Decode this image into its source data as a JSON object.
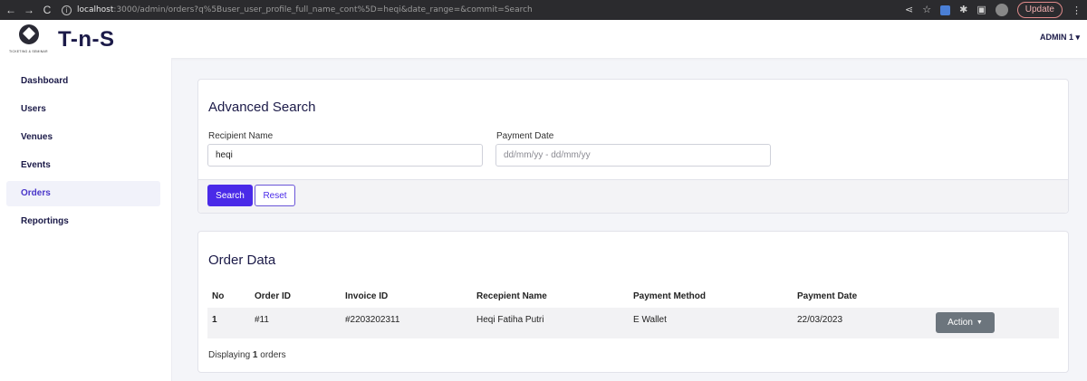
{
  "browser": {
    "url_host": "localhost",
    "url_rest": ":3000/admin/orders?q%5Buser_user_profile_full_name_cont%5D=heqi&date_range=&commit=Search",
    "update_label": "Update",
    "nav_back": "←",
    "nav_forward": "→",
    "nav_reload": "C",
    "share_icon": "share-icon",
    "star_icon": "star-icon"
  },
  "header": {
    "brand": "T-n-S",
    "logo_tagline": "TICKETING & SEMINAR",
    "admin_label": "ADMIN 1 ▾"
  },
  "sidebar": {
    "items": [
      {
        "label": "Dashboard"
      },
      {
        "label": "Users"
      },
      {
        "label": "Venues"
      },
      {
        "label": "Events"
      },
      {
        "label": "Orders",
        "active": true
      },
      {
        "label": "Reportings"
      }
    ]
  },
  "search": {
    "title": "Advanced Search",
    "recipient_label": "Recipient Name",
    "recipient_value": "heqi",
    "payment_label": "Payment Date",
    "payment_placeholder": "dd/mm/yy - dd/mm/yy",
    "search_button": "Search",
    "reset_button": "Reset"
  },
  "orders": {
    "title": "Order Data",
    "columns": [
      "No",
      "Order ID",
      "Invoice ID",
      "Recepient Name",
      "Payment Method",
      "Payment Date"
    ],
    "rows": [
      {
        "no": "1",
        "order_id": "#11",
        "invoice_id": "#2203202311",
        "recipient": "Heqi Fatiha Putri",
        "method": "E Wallet",
        "date": "22/03/2023",
        "action": "Action"
      }
    ],
    "footer_prefix": "Displaying",
    "footer_count": "1",
    "footer_suffix": "orders"
  },
  "colors": {
    "accent": "#4a2ae8",
    "brand": "#1b1a48",
    "action_button": "#6c757d"
  }
}
